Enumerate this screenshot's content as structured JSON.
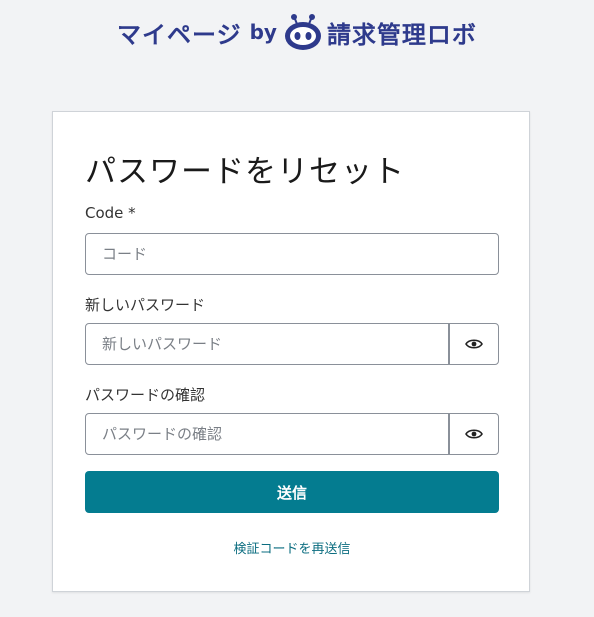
{
  "brand": {
    "name_left": "マイページ",
    "by": "by",
    "name_right": "請求管理ロボ",
    "logo_icon": "robot-face-icon",
    "color": "#2e3a8c"
  },
  "form": {
    "title": "パスワードをリセット",
    "code": {
      "label": "Code *",
      "placeholder": "コード",
      "value": ""
    },
    "new_password": {
      "label": "新しいパスワード",
      "placeholder": "新しいパスワード",
      "value": "",
      "toggle_icon": "eye-icon"
    },
    "confirm_password": {
      "label": "パスワードの確認",
      "placeholder": "パスワードの確認",
      "value": "",
      "toggle_icon": "eye-icon"
    },
    "submit_label": "送信",
    "resend_link": "検証コードを再送信"
  },
  "colors": {
    "background": "#f2f3f5",
    "primary_button": "#047c90",
    "link": "#0b6d80"
  }
}
